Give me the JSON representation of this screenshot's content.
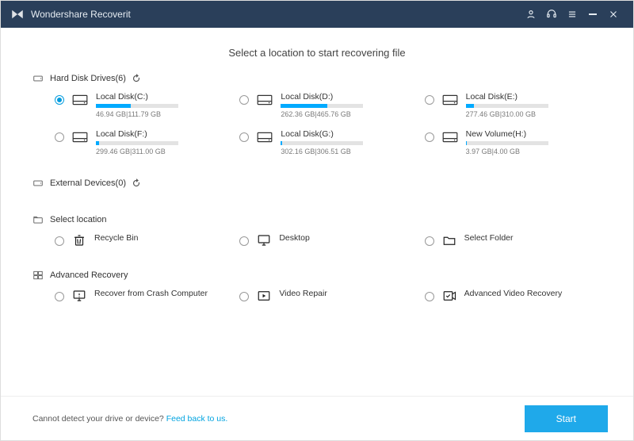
{
  "titlebar": {
    "title": "Wondershare Recoverit"
  },
  "heading": "Select a location to start recovering file",
  "sections": {
    "hdd": {
      "label": "Hard Disk Drives(6)"
    },
    "ext": {
      "label": "External Devices(0)"
    },
    "loc": {
      "label": "Select location"
    },
    "adv": {
      "label": "Advanced Recovery"
    }
  },
  "drives": [
    {
      "label": "Local Disk(C:)",
      "sub": "46.94 GB|111.79 GB",
      "pct": 42,
      "selected": true
    },
    {
      "label": "Local Disk(D:)",
      "sub": "262.36 GB|465.76 GB",
      "pct": 56,
      "selected": false
    },
    {
      "label": "Local Disk(E:)",
      "sub": "277.46 GB|310.00 GB",
      "pct": 10,
      "selected": false
    },
    {
      "label": "Local Disk(F:)",
      "sub": "299.46 GB|311.00 GB",
      "pct": 4,
      "selected": false
    },
    {
      "label": "Local Disk(G:)",
      "sub": "302.16 GB|306.51 GB",
      "pct": 2,
      "selected": false
    },
    {
      "label": "New Volume(H:)",
      "sub": "3.97 GB|4.00 GB",
      "pct": 1,
      "selected": false
    }
  ],
  "locations": [
    {
      "label": "Recycle Bin"
    },
    {
      "label": "Desktop"
    },
    {
      "label": "Select Folder"
    }
  ],
  "advanced": [
    {
      "label": "Recover from Crash Computer"
    },
    {
      "label": "Video Repair"
    },
    {
      "label": "Advanced Video Recovery"
    }
  ],
  "footer": {
    "msg": "Cannot detect your drive or device? ",
    "link": "Feed back to us.",
    "start": "Start"
  }
}
